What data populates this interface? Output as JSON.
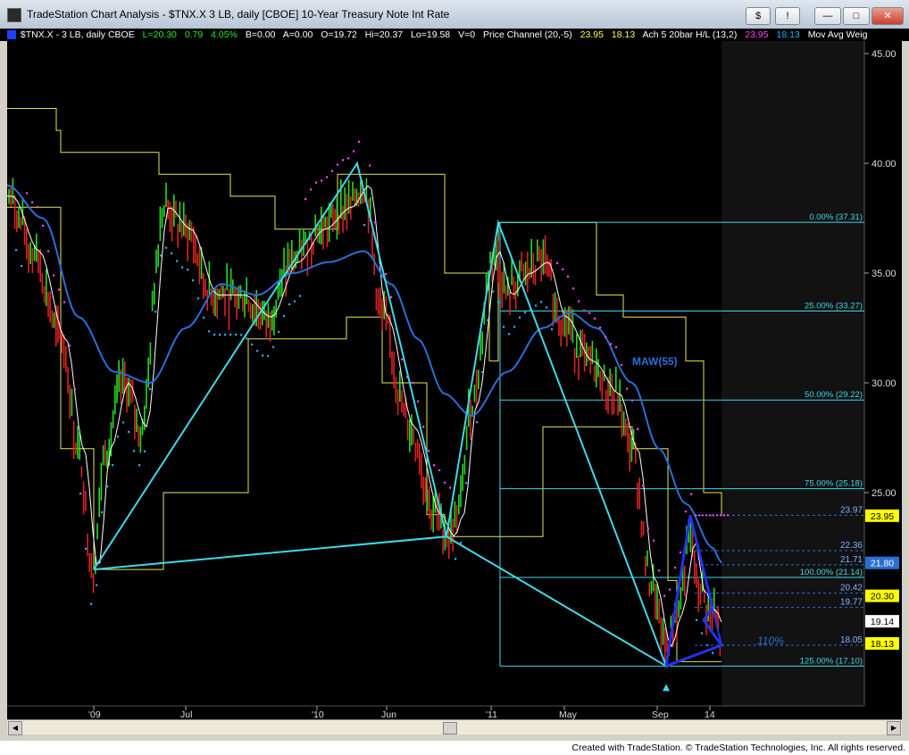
{
  "window": {
    "title": "TradeStation Chart Analysis - $TNX.X 3 LB, daily [CBOE] 10-Year Treasury Note Int Rate",
    "buttons": [
      "$",
      "!"
    ]
  },
  "status": {
    "symbol": "$TNX.X - 3 LB, daily  CBOE",
    "last": "L=20.30",
    "change": "0.79",
    "pct": "4.05%",
    "bid": "B=0.00",
    "ask": "A=0.00",
    "open": "O=19.72",
    "high": "Hi=20.37",
    "low": "Lo=19.58",
    "vol": "V=0",
    "pc_label": "Price Channel (20,-5)",
    "pc_high": "23.95",
    "pc_low": "18.13",
    "ach_label": "Ach 5 20bar H/L (13,2)",
    "ach_high": "23.95",
    "ach_low": "18.13",
    "maw_label": "Mov Avg Weig"
  },
  "chart": {
    "y_ticks": [
      "45.00",
      "40.00",
      "35.00",
      "30.00",
      "25.00"
    ],
    "x_ticks": [
      "'09",
      "Jul",
      "'10",
      "Jun",
      "'11",
      "May",
      "Sep",
      "14"
    ],
    "fib_labels": [
      "0.00% (37.31)",
      "25.00% (33.27)",
      "50.00% (29.22)",
      "75.00% (25.18)",
      "100.00% (21.14)",
      "125.00% (17.10)"
    ],
    "level_labels": [
      "23.97",
      "22.36",
      "21.71",
      "20.42",
      "19.77",
      "18.05"
    ],
    "price_tags": [
      "23.95",
      "21.80",
      "20.30",
      "19.14",
      "18.13"
    ],
    "maw_label": "MAW(55)",
    "pct_label": "110%"
  },
  "footer": {
    "text": "Created with TradeStation. © TradeStation Technologies, Inc. All rights reserved."
  },
  "colors": {
    "background": "#000000",
    "bars_up": "#22dd22",
    "bars_down": "#dd2222",
    "channel": "#e8e850",
    "maw": "#2a6fd6",
    "fib": "#40d8e8",
    "magenta": "#ff44ff",
    "pattern": "#2233ee",
    "thin_ma": "#ffffff"
  }
}
